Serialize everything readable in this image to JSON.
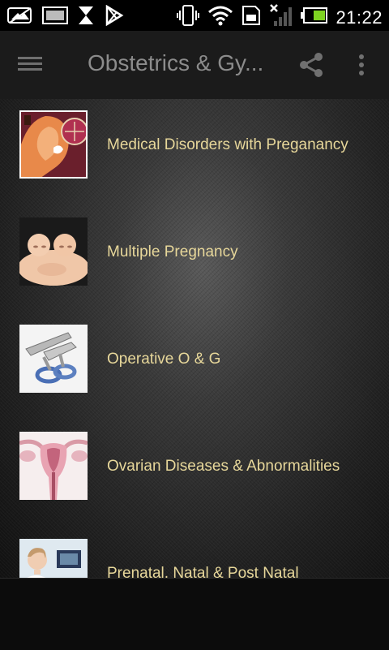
{
  "status_bar": {
    "time": "21:22",
    "icons": [
      "image-icon",
      "gallery-icon",
      "hourglass-icon",
      "play-store-icon",
      "vibrate-icon",
      "wifi-icon",
      "sd-card-icon",
      "no-signal-icon",
      "battery-icon"
    ]
  },
  "appbar": {
    "title": "Obstetrics & Gy...",
    "menu_icon": "hamburger-menu-icon",
    "share_icon": "share-icon",
    "more_icon": "overflow-menu-icon"
  },
  "list": {
    "items": [
      {
        "label": "Medical Disorders with Preganancy",
        "thumb": "pregnancy-illustration"
      },
      {
        "label": "Multiple Pregnancy",
        "thumb": "twin-babies-photo"
      },
      {
        "label": "Operative O & G",
        "thumb": "surgical-instrument-photo"
      },
      {
        "label": "Ovarian Diseases & Abnormalities",
        "thumb": "uterus-illustration"
      },
      {
        "label": "Prenatal, Natal & Post Natal",
        "thumb": "doctor-ultrasound-photo"
      }
    ]
  },
  "colors": {
    "label": "#e7d79a",
    "appbar": "#1b1b1b",
    "title": "#8c8c8c"
  }
}
